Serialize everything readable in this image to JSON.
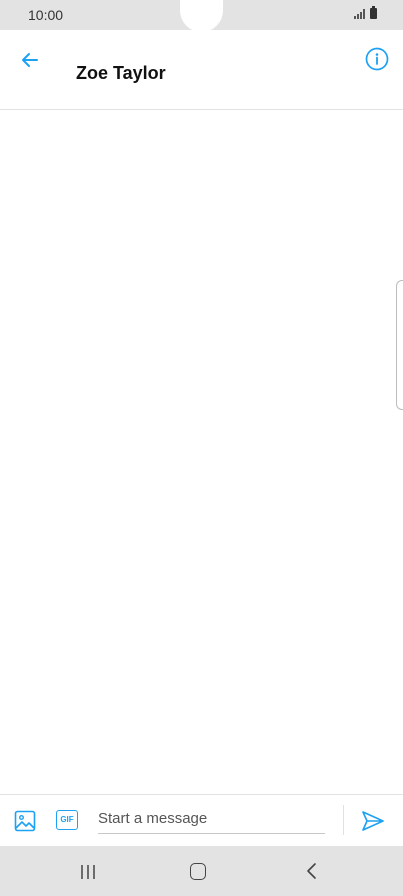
{
  "status_bar": {
    "time": "10:00"
  },
  "header": {
    "title": "Zoe Taylor"
  },
  "composer": {
    "placeholder": "Start a message",
    "gif_label": "GIF"
  },
  "colors": {
    "accent": "#1da1f2",
    "system_bar": "#e3e3e3"
  },
  "icons": {
    "back": "arrow-left-icon",
    "info": "info-circle-icon",
    "media": "image-icon",
    "gif": "gif-icon",
    "send": "send-icon"
  }
}
